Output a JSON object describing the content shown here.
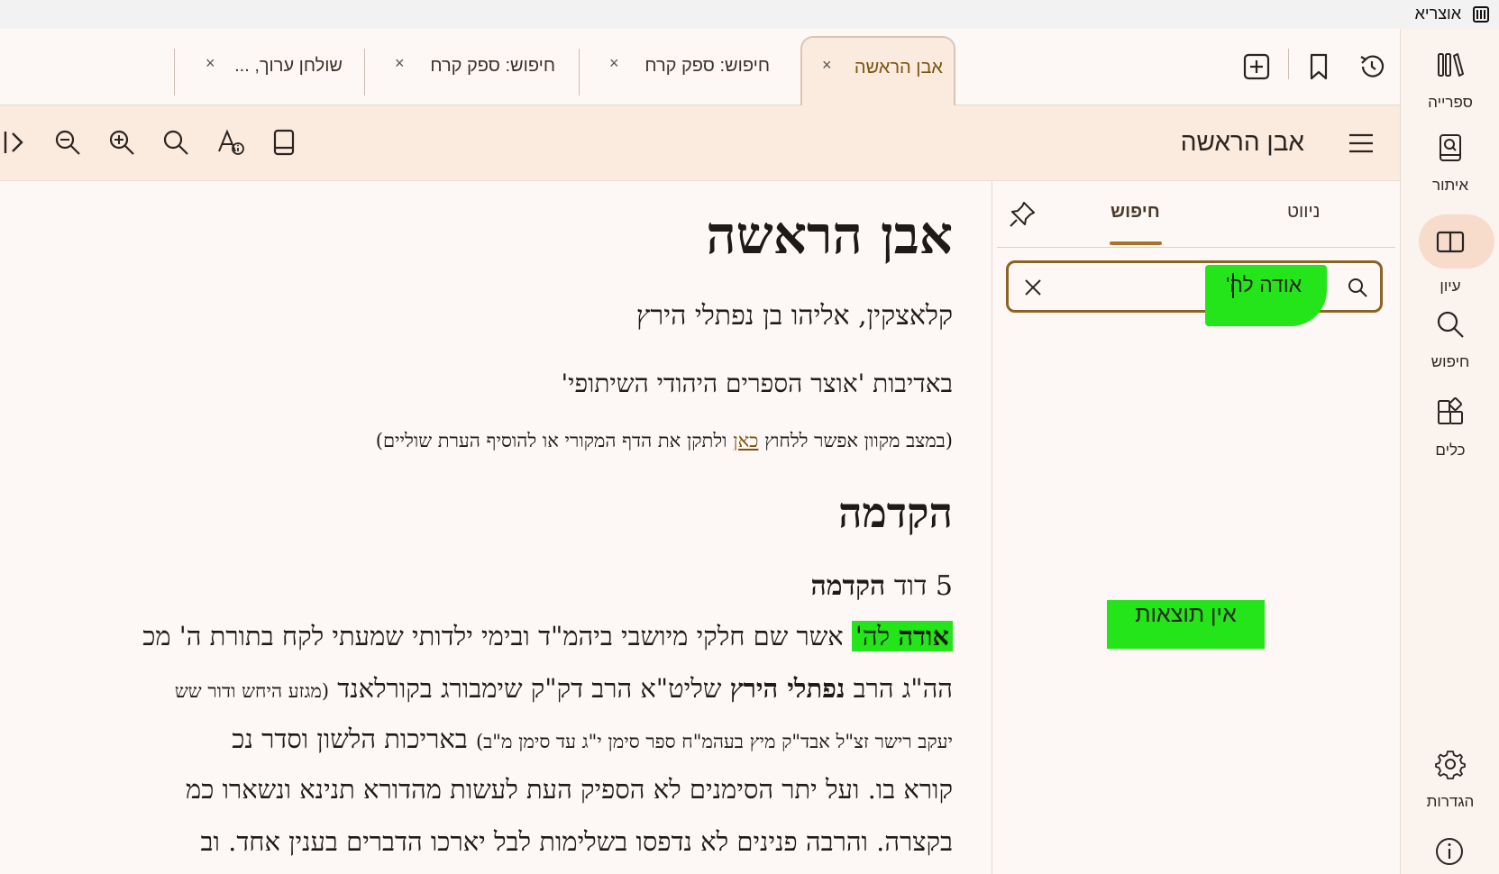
{
  "app": {
    "title": "אוצריא",
    "logo_icon": "book-icon"
  },
  "rail": {
    "items": [
      {
        "label": "ספרייה",
        "icon": "library-icon"
      },
      {
        "label": "איתור",
        "icon": "find-book-icon"
      },
      {
        "label": "עיון",
        "icon": "open-book-icon",
        "active": true
      },
      {
        "label": "חיפוש",
        "icon": "search-icon"
      },
      {
        "label": "כלים",
        "icon": "widgets-icon"
      }
    ],
    "settings_label": "הגדרות",
    "info_icon": "info-icon"
  },
  "tabs": [
    {
      "label": "אבן הראשה",
      "active": true
    },
    {
      "label": "חיפוש: ספק קרח"
    },
    {
      "label": "חיפוש: ספק קרח"
    },
    {
      "label": "שולחן ערוך, ..."
    }
  ],
  "tab_close_glyph": "×",
  "toolbar": {
    "doc_title": "אבן הראשה",
    "icons": [
      "menu-icon",
      "book-view-icon",
      "font-settings-icon",
      "search-icon",
      "zoom-in-icon",
      "zoom-out-icon",
      "last-page-icon"
    ]
  },
  "panel": {
    "tabs": {
      "search": "חיפוש",
      "navigation": "ניווט"
    },
    "search_value": "אודה לה'",
    "no_results": "אין תוצאות"
  },
  "document": {
    "title": "אבן הראשה",
    "author": "קלאצקין, אליהו בן נפתלי הירץ",
    "courtesy": "באדיבות 'אוצר הספרים היהודי השיתופי'",
    "note_before": "(במצב מקוון אפשר ללחוץ ",
    "note_link": "כאן",
    "note_after": " ולתקן את הדף המקורי או להוסיף הערת שוליים)",
    "section_heading": "הקדמה",
    "sub_prefix": "5 דוד ",
    "sub_bold": "הקדמה",
    "p1_hl_bold": "אודה",
    "p1_hl_rest": " לה'",
    "p1_rest": " אשר שם חלקי מיושבי ביהמ\"ד ובימי ילדותי שמעתי לקח בתורת ה' מכ",
    "p2_a": "הה\"ג הרב ",
    "p2_bold": "נפתלי הירץ",
    "p2_b": " שליט\"א הרב דק\"ק שימבורג בקורלאנד ",
    "p2_small": "(מגזע היחש ודור שש",
    "p3_small": "יעקב רישר זצ\"ל אבד\"ק מיץ בעהמ\"ח ספר סימן י\"ג עד סימן מ\"ב)",
    "p3_rest": " באריכות הלשון וסדר נכ",
    "p4": "קורא בו. ועל יתר הסימנים לא הספיק העת לעשות מהדורא תנינא ונשארו כמ",
    "p5": "בקצרה. והרבה פנינים לא נדפסו בשלימות לבל יארכו הדברים בענין אחד. וב"
  }
}
